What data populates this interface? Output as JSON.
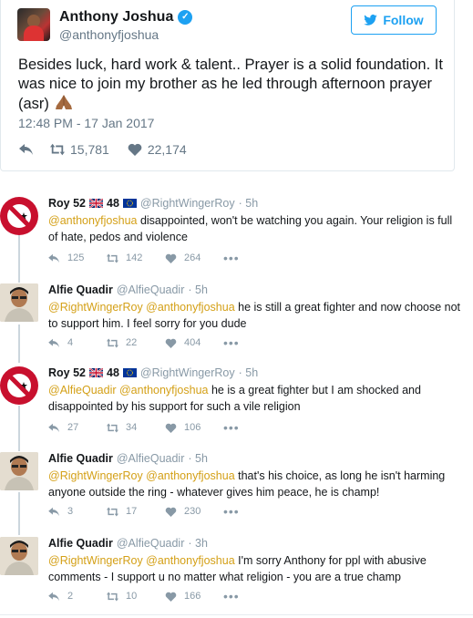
{
  "tweet": {
    "name": "Anthony Joshua",
    "handle": "@anthonyfjoshua",
    "follow_label": "Follow",
    "text": "Besides luck, hard work & talent.. Prayer is a solid foundation. It was nice to join my brother as he led through afternoon prayer (asr)",
    "timestamp": "12:48 PM - 17 Jan 2017",
    "retweets": "15,781",
    "likes": "22,174"
  },
  "replies": [
    {
      "name": "Roy 52",
      "name_suffix": "48",
      "handle": "@RightWingerRoy",
      "time": "· 5h",
      "mentions": "@anthonyfjoshua",
      "text": " disappointed, won't be watching you again. Your religion is full of hate, pedos and violence",
      "replies_count": "125",
      "retweets": "142",
      "likes": "264"
    },
    {
      "name": "Alfie Quadir",
      "handle": "@AlfieQuadir",
      "time": "· 5h",
      "mentions": "@RightWingerRoy @anthonyfjoshua",
      "text": " he is still a great fighter and now choose not to support him. I feel sorry for you dude",
      "replies_count": "4",
      "retweets": "22",
      "likes": "404"
    },
    {
      "name": "Roy 52",
      "name_suffix": "48",
      "handle": "@RightWingerRoy",
      "time": "· 5h",
      "mentions": "@AlfieQuadir @anthonyfjoshua",
      "text": " he is a great fighter but I am shocked and disappointed by his support for such a vile religion",
      "replies_count": "27",
      "retweets": "34",
      "likes": "106"
    },
    {
      "name": "Alfie Quadir",
      "handle": "@AlfieQuadir",
      "time": "· 5h",
      "mentions": "@RightWingerRoy @anthonyfjoshua",
      "text": " that's his choice, as long he isn't harming anyone outside the ring - whatever gives him peace, he is champ!",
      "replies_count": "3",
      "retweets": "17",
      "likes": "230"
    },
    {
      "name": "Alfie Quadir",
      "handle": "@AlfieQuadir",
      "time": "· 3h",
      "mentions": "@RightWingerRoy @anthonyfjoshua",
      "text": " I'm sorry Anthony for ppl with abusive comments - I support u no matter what religion - you are a true champ",
      "replies_count": "2",
      "retweets": "10",
      "likes": "166"
    }
  ],
  "icons": {
    "verified": "verified-badge-icon",
    "follow": "twitter-bird-icon",
    "reply": "reply-icon",
    "retweet": "retweet-icon",
    "like": "heart-icon",
    "more": "more-dots-icon",
    "pray": "folded-hands-emoji",
    "uk_flag": "uk-flag-icon",
    "eu_flag": "eu-flag-icon"
  },
  "colors": {
    "brand": "#1da1f2",
    "mention": "#d4a017",
    "muted": "#657786"
  }
}
